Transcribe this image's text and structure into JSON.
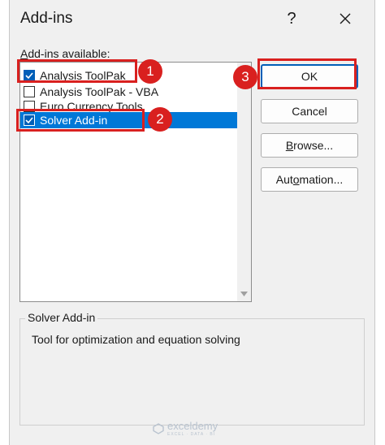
{
  "dialog": {
    "title": "Add-ins",
    "help_label": "?",
    "close_icon": "close-icon"
  },
  "addins": {
    "label_prefix": "A",
    "label_rest": "dd-ins available:",
    "items": [
      {
        "label": "Analysis ToolPak",
        "checked": true,
        "selected": false
      },
      {
        "label": "Analysis ToolPak - VBA",
        "checked": false,
        "selected": false
      },
      {
        "label": "Euro Currency Tools",
        "checked": false,
        "selected": false
      },
      {
        "label": "Solver Add-in",
        "checked": true,
        "selected": true
      }
    ]
  },
  "buttons": {
    "ok": "OK",
    "cancel": "Cancel",
    "browse_prefix": "B",
    "browse_rest": "rowse...",
    "automation_prefix": "Aut",
    "automation_u": "o",
    "automation_rest": "mation..."
  },
  "description": {
    "title": "Solver Add-in",
    "text": "Tool for optimization and equation solving"
  },
  "callouts": [
    "1",
    "2",
    "3"
  ],
  "watermark": {
    "brand": "exceldemy",
    "tagline": "EXCEL · DATA · BI"
  },
  "colors": {
    "accent": "#0078d7",
    "callout": "#d9201f",
    "dialog_bg": "#f0f0f0"
  }
}
